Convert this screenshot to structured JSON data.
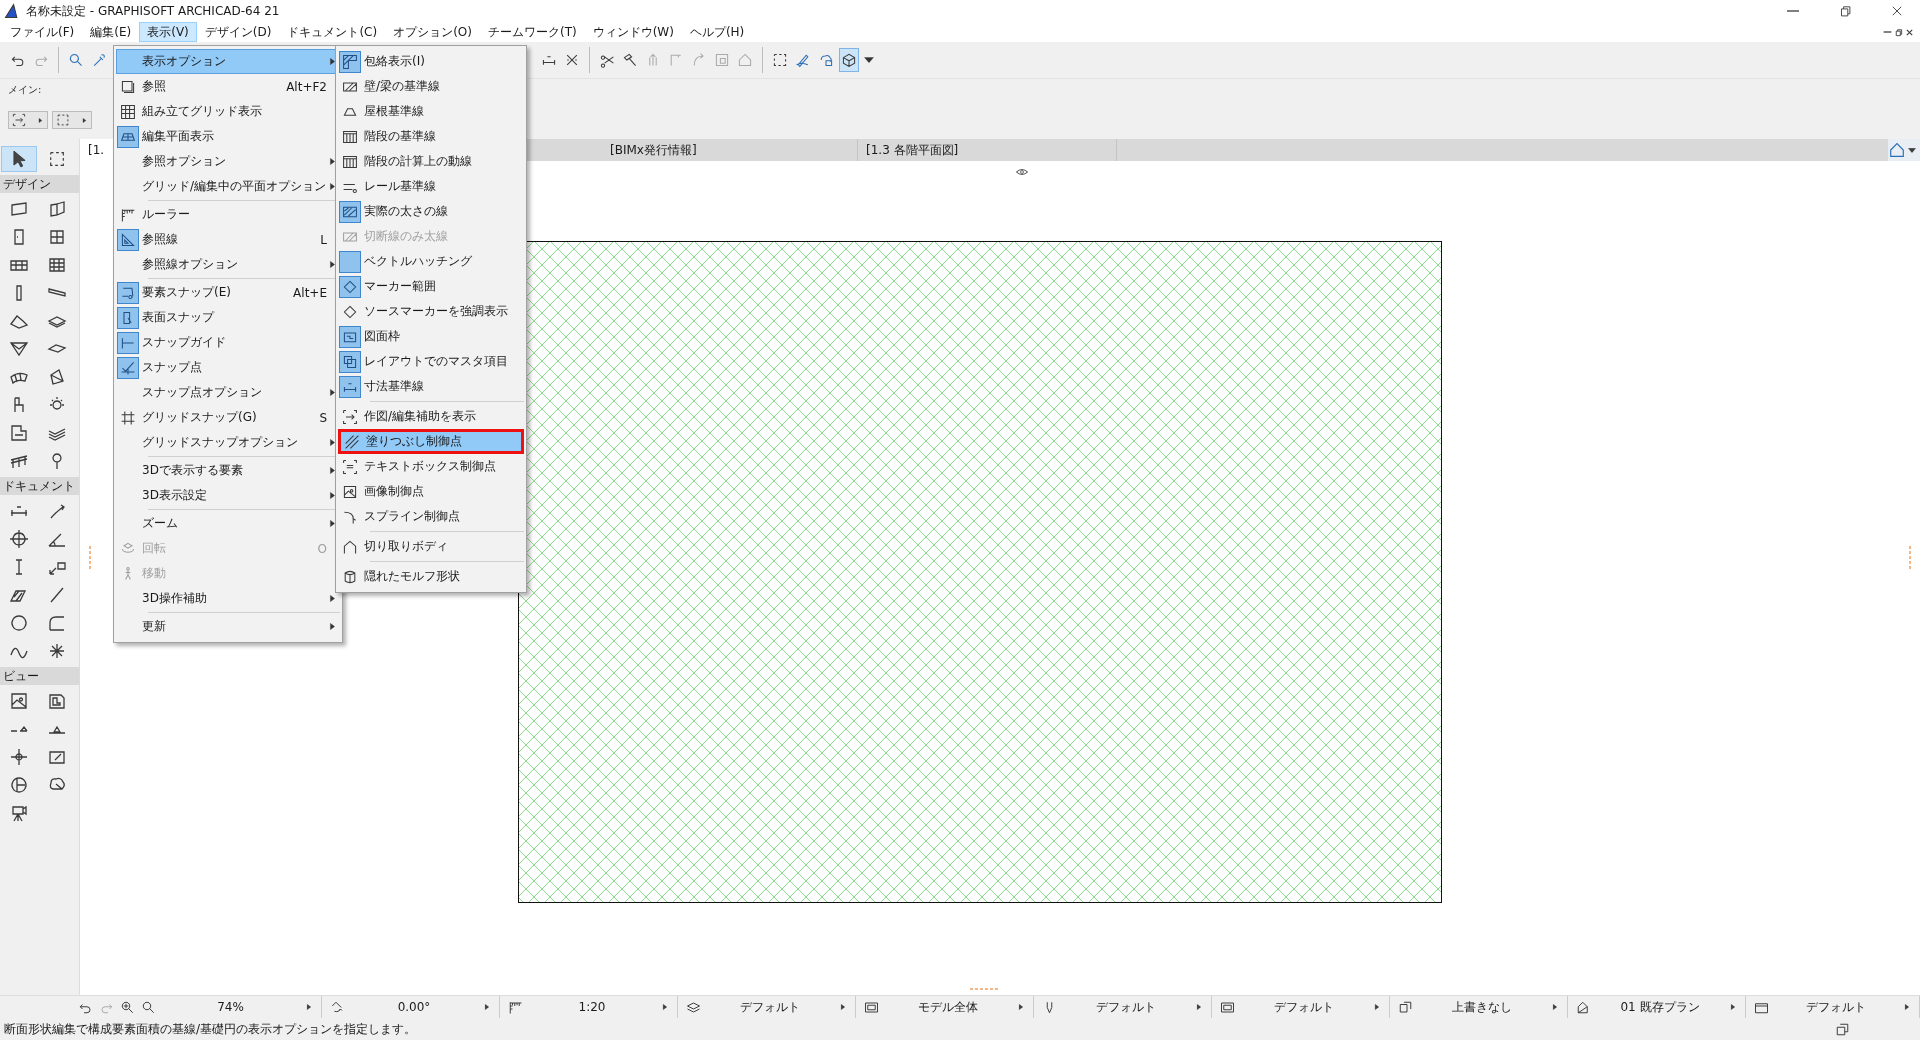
{
  "window": {
    "title": "名称未設定 - GRAPHISOFT ARCHICAD-64 21"
  },
  "menu_bar": [
    {
      "label": "ファイル(F)",
      "selected": false
    },
    {
      "label": "編集(E)",
      "selected": false
    },
    {
      "label": "表示(V)",
      "selected": true
    },
    {
      "label": "デザイン(D)",
      "selected": false
    },
    {
      "label": "ドキュメント(C)",
      "selected": false
    },
    {
      "label": "オプション(O)",
      "selected": false
    },
    {
      "label": "チームワーク(T)",
      "selected": false
    },
    {
      "label": "ウィンドウ(W)",
      "selected": false
    },
    {
      "label": "ヘルプ(H)",
      "selected": false
    }
  ],
  "toolbar": {
    "display_toggle": {
      "selected": true
    }
  },
  "info_box": {
    "label": "メイン:"
  },
  "toolbox": {
    "pointer_tool": {
      "selected": true
    },
    "marquee_tool": {
      "selected": false
    },
    "sections": [
      {
        "label": "デザイン"
      },
      {
        "label": "ドキュメント"
      },
      {
        "label": "ビュー"
      }
    ]
  },
  "tabs": [
    {
      "label": "[1.",
      "selected": true
    },
    {
      "label": "[BIMx発行情報]",
      "selected": false
    },
    {
      "label": "[1.3 各階平面図]",
      "selected": false
    }
  ],
  "view_menu": {
    "items": [
      {
        "kind": "item",
        "label": "表示オプション",
        "has_submenu": true,
        "checked": false,
        "disabled": false,
        "selected": true
      },
      {
        "kind": "item",
        "label": "参照",
        "shortcut": "Alt+F2",
        "has_submenu": false,
        "checked": false,
        "disabled": false,
        "selected": false
      },
      {
        "kind": "item",
        "label": "組み立てグリッド表示",
        "has_submenu": false,
        "checked": false,
        "disabled": false,
        "selected": false
      },
      {
        "kind": "item",
        "label": "編集平面表示",
        "has_submenu": false,
        "checked": true,
        "disabled": false,
        "selected": false
      },
      {
        "kind": "item",
        "label": "参照オプション",
        "has_submenu": true,
        "checked": false,
        "disabled": false,
        "selected": false
      },
      {
        "kind": "item",
        "label": "グリッド/編集中の平面オプション",
        "has_submenu": true,
        "checked": false,
        "disabled": false,
        "selected": false
      },
      {
        "kind": "separator"
      },
      {
        "kind": "item",
        "label": "ルーラー",
        "has_submenu": false,
        "checked": false,
        "disabled": false,
        "selected": false
      },
      {
        "kind": "item",
        "label": "参照線",
        "shortcut": "L",
        "has_submenu": false,
        "checked": true,
        "disabled": false,
        "selected": false
      },
      {
        "kind": "item",
        "label": "参照線オプション",
        "has_submenu": true,
        "checked": false,
        "disabled": false,
        "selected": false
      },
      {
        "kind": "separator"
      },
      {
        "kind": "item",
        "label": "要素スナップ(E)",
        "shortcut": "Alt+E",
        "has_submenu": false,
        "checked": true,
        "disabled": false,
        "selected": false
      },
      {
        "kind": "item",
        "label": "表面スナップ",
        "has_submenu": false,
        "checked": true,
        "disabled": false,
        "selected": false
      },
      {
        "kind": "item",
        "label": "スナップガイド",
        "has_submenu": false,
        "checked": true,
        "disabled": false,
        "selected": false
      },
      {
        "kind": "item",
        "label": "スナップ点",
        "has_submenu": false,
        "checked": true,
        "disabled": false,
        "selected": false
      },
      {
        "kind": "item",
        "label": "スナップ点オプション",
        "has_submenu": true,
        "checked": false,
        "disabled": false,
        "selected": false
      },
      {
        "kind": "item",
        "label": "グリッドスナップ(G)",
        "shortcut": "S",
        "has_submenu": false,
        "checked": false,
        "disabled": false,
        "selected": false
      },
      {
        "kind": "item",
        "label": "グリッドスナップオプション",
        "has_submenu": true,
        "checked": false,
        "disabled": false,
        "selected": false
      },
      {
        "kind": "separator"
      },
      {
        "kind": "item",
        "label": "3Dで表示する要素",
        "has_submenu": true,
        "checked": false,
        "disabled": false,
        "selected": false
      },
      {
        "kind": "item",
        "label": "3D表示設定",
        "has_submenu": true,
        "checked": false,
        "disabled": false,
        "selected": false
      },
      {
        "kind": "separator"
      },
      {
        "kind": "item",
        "label": "ズーム",
        "has_submenu": true,
        "checked": false,
        "disabled": false,
        "selected": false
      },
      {
        "kind": "item",
        "label": "回転",
        "shortcut": "O",
        "has_submenu": false,
        "checked": false,
        "disabled": true,
        "selected": false
      },
      {
        "kind": "item",
        "label": "移動",
        "has_submenu": false,
        "checked": false,
        "disabled": true,
        "selected": false
      },
      {
        "kind": "item",
        "label": "3D操作補助",
        "has_submenu": true,
        "checked": false,
        "disabled": false,
        "selected": false
      },
      {
        "kind": "separator"
      },
      {
        "kind": "item",
        "label": "更新",
        "has_submenu": true,
        "checked": false,
        "disabled": false,
        "selected": false
      }
    ]
  },
  "display_options_submenu": {
    "items": [
      {
        "kind": "item",
        "label": "包絡表示(I)",
        "checked": true,
        "disabled": false,
        "selected": false
      },
      {
        "kind": "item",
        "label": "壁/梁の基準線",
        "checked": false,
        "disabled": false,
        "selected": false
      },
      {
        "kind": "item",
        "label": "屋根基準線",
        "checked": false,
        "disabled": false,
        "selected": false
      },
      {
        "kind": "item",
        "label": "階段の基準線",
        "checked": false,
        "disabled": false,
        "selected": false
      },
      {
        "kind": "item",
        "label": "階段の計算上の動線",
        "checked": false,
        "disabled": false,
        "selected": false
      },
      {
        "kind": "item",
        "label": "レール基準線",
        "checked": false,
        "disabled": false,
        "selected": false
      },
      {
        "kind": "item",
        "label": "実際の太さの線",
        "checked": true,
        "disabled": false,
        "selected": false
      },
      {
        "kind": "item",
        "label": "切断線のみ太線",
        "checked": false,
        "disabled": true,
        "selected": false
      },
      {
        "kind": "item",
        "label": "ベクトルハッチング",
        "checked": true,
        "disabled": false,
        "selected": false
      },
      {
        "kind": "item",
        "label": "マーカー範囲",
        "checked": true,
        "disabled": false,
        "selected": false
      },
      {
        "kind": "item",
        "label": "ソースマーカーを強調表示",
        "checked": false,
        "disabled": false,
        "selected": false
      },
      {
        "kind": "item",
        "label": "図面枠",
        "checked": true,
        "disabled": false,
        "selected": false
      },
      {
        "kind": "item",
        "label": "レイアウトでのマスタ項目",
        "checked": true,
        "disabled": false,
        "selected": false
      },
      {
        "kind": "item",
        "label": "寸法基準線",
        "checked": true,
        "disabled": false,
        "selected": false
      },
      {
        "kind": "separator"
      },
      {
        "kind": "item",
        "label": "作図/編集補助を表示",
        "checked": false,
        "disabled": false,
        "selected": false
      },
      {
        "kind": "item",
        "label": "塗りつぶし制御点",
        "checked": false,
        "disabled": false,
        "selected": true
      },
      {
        "kind": "item",
        "label": "テキストボックス制御点",
        "checked": false,
        "disabled": false,
        "selected": false
      },
      {
        "kind": "item",
        "label": "画像制御点",
        "checked": false,
        "disabled": false,
        "selected": false
      },
      {
        "kind": "item",
        "label": "スプライン制御点",
        "checked": false,
        "disabled": false,
        "selected": false
      },
      {
        "kind": "separator"
      },
      {
        "kind": "item",
        "label": "切り取りボディ",
        "checked": false,
        "disabled": false,
        "selected": false
      },
      {
        "kind": "separator"
      },
      {
        "kind": "item",
        "label": "隠れたモルフ形状",
        "checked": false,
        "disabled": false,
        "selected": false
      }
    ]
  },
  "status_controls": [
    {
      "value": "74%"
    },
    {
      "value": "0.00°"
    },
    {
      "value": "1:20"
    },
    {
      "value": "デフォルト"
    },
    {
      "value": "モデル全体"
    },
    {
      "value": "デフォルト"
    },
    {
      "value": "デフォルト"
    },
    {
      "value": "上書きなし"
    },
    {
      "value": "01 既存プラン"
    },
    {
      "value": "デフォルト"
    }
  ],
  "status_bar": {
    "text": "断面形状編集で構成要素面積の基線/基礎円の表示オプションを指定します。"
  }
}
